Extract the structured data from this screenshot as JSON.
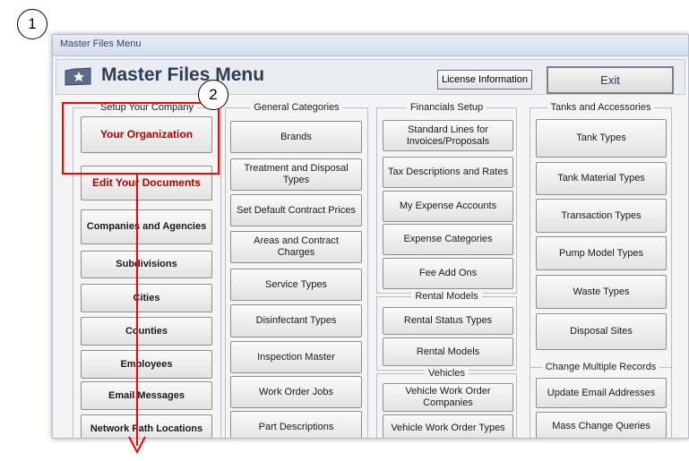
{
  "callouts": [
    "1",
    "2"
  ],
  "window": {
    "title": "Master Files Menu",
    "header_title": "Master Files Menu",
    "license_label": "License Information",
    "exit_label": "Exit"
  },
  "groups": {
    "setup": {
      "title": "Setup Your Company",
      "buttons": [
        "Your Organization",
        "Edit Your Documents",
        "Companies and Agencies",
        "Subdivisions",
        "Cities",
        "Counties",
        "Employees",
        "Email Messages",
        "Network Path Locations"
      ]
    },
    "general": {
      "title": "General Categories",
      "buttons": [
        "Brands",
        "Treatment and Disposal Types",
        "Set Default Contract Prices",
        "Areas and Contract Charges",
        "Service Types",
        "Disinfectant Types",
        "Inspection Master",
        "Work Order Jobs",
        "Part Descriptions"
      ]
    },
    "financials": {
      "title": "Financials Setup",
      "buttons": [
        "Standard Lines for Invoices/Proposals",
        "Tax Descriptions and Rates",
        "My Expense Accounts",
        "Expense Categories",
        "Fee Add Ons"
      ]
    },
    "rental": {
      "title": "Rental Models",
      "buttons": [
        "Rental Status Types",
        "Rental Models"
      ]
    },
    "vehicles": {
      "title": "Vehicles",
      "buttons": [
        "Vehicle Work Order Companies",
        "Vehicle Work Order Types"
      ]
    },
    "tanks": {
      "title": "Tanks and Accessories",
      "buttons": [
        "Tank Types",
        "Tank Material Types",
        "Transaction Types",
        "Pump Model Types",
        "Waste Types",
        "Disposal Sites"
      ]
    },
    "change": {
      "title": "Change Multiple Records",
      "buttons": [
        "Update Email Addresses",
        "Mass Change Queries"
      ]
    }
  },
  "colors": {
    "highlight": "#ff0000",
    "accent_text": "#b30000",
    "title_text": "#2e3d55"
  }
}
